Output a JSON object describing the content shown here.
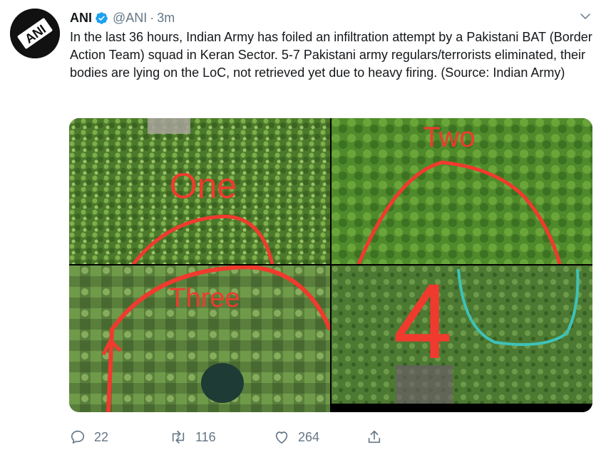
{
  "tweet": {
    "author_name": "ANI",
    "author_handle": "@ANI",
    "separator": "·",
    "time": "3m",
    "text": "In the last 36 hours, Indian Army has foiled an infiltration attempt by a Pakistani BAT (Border Action Team) squad in Keran Sector. 5-7 Pakistani army regulars/terrorists eliminated, their bodies are lying on the LoC, not retrieved yet due to heavy firing. (Source: Indian Army)",
    "avatar_logo_text": "ANI",
    "verified_icon": "verified-badge-icon",
    "menu_icon": "chevron-down-icon"
  },
  "media": [
    {
      "annotation": "One"
    },
    {
      "annotation": "Two"
    },
    {
      "annotation": "Three"
    },
    {
      "annotation": "4"
    }
  ],
  "actions": {
    "reply_count": "22",
    "retweet_count": "116",
    "like_count": "264",
    "icons": [
      "reply-icon",
      "retweet-icon",
      "like-icon",
      "share-icon"
    ]
  },
  "colors": {
    "verified": "#1da1f2",
    "secondary_text": "#657786",
    "annotation_red": "#f03a2e",
    "annotation_teal": "#3ec2b8"
  }
}
